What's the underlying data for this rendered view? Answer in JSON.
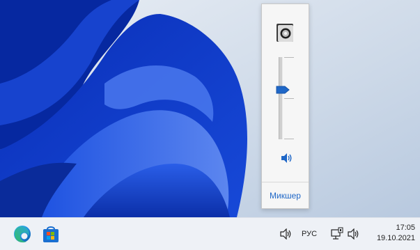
{
  "flyout": {
    "mixer_label": "Микшер",
    "volume_level_percent": 60
  },
  "taskbar": {
    "apps": [
      {
        "name": "edge-icon"
      },
      {
        "name": "store-icon"
      }
    ],
    "tray": {
      "language": "РУС",
      "time": "17:05",
      "date": "19.10.2021"
    }
  },
  "colors": {
    "accent": "#1f67c7",
    "wallpaper_base": "#c9d6e6",
    "taskbar": "#eef1f6"
  }
}
